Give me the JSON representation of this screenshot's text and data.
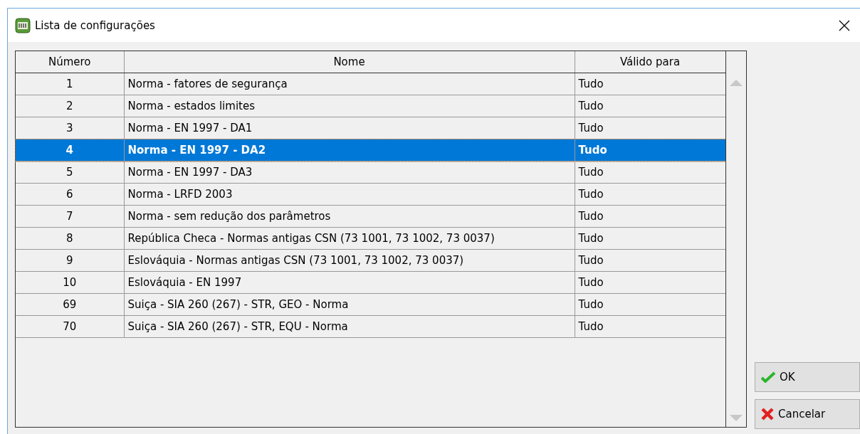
{
  "window": {
    "title": "Lista de configurações"
  },
  "table": {
    "columns": [
      "Número",
      "Nome",
      "Válido para"
    ],
    "rows": [
      {
        "number": "1",
        "name": "Norma - fatores de segurança",
        "valid_for": "Tudo",
        "selected": false
      },
      {
        "number": "2",
        "name": "Norma - estados limites",
        "valid_for": "Tudo",
        "selected": false
      },
      {
        "number": "3",
        "name": "Norma - EN 1997 - DA1",
        "valid_for": "Tudo",
        "selected": false
      },
      {
        "number": "4",
        "name": "Norma - EN 1997 - DA2",
        "valid_for": "Tudo",
        "selected": true
      },
      {
        "number": "5",
        "name": "Norma - EN 1997 - DA3",
        "valid_for": "Tudo",
        "selected": false
      },
      {
        "number": "6",
        "name": "Norma - LRFD 2003",
        "valid_for": "Tudo",
        "selected": false
      },
      {
        "number": "7",
        "name": "Norma - sem redução dos parâmetros",
        "valid_for": "Tudo",
        "selected": false
      },
      {
        "number": "8",
        "name": "República Checa - Normas antigas CSN (73 1001, 73 1002, 73 0037)",
        "valid_for": "Tudo",
        "selected": false
      },
      {
        "number": "9",
        "name": "Eslováquia - Normas antigas CSN (73 1001, 73 1002, 73 0037)",
        "valid_for": "Tudo",
        "selected": false
      },
      {
        "number": "10",
        "name": "Eslováquia - EN 1997",
        "valid_for": "Tudo",
        "selected": false
      },
      {
        "number": "69",
        "name": "Suiça - SIA 260 (267) - STR, GEO - Norma",
        "valid_for": "Tudo",
        "selected": false
      },
      {
        "number": "70",
        "name": "Suiça - SIA 260 (267) - STR, EQU - Norma",
        "valid_for": "Tudo",
        "selected": false
      }
    ]
  },
  "buttons": [
    {
      "label": "OK",
      "kind": "ok"
    },
    {
      "label": "Cancelar",
      "kind": "cancel"
    }
  ]
}
